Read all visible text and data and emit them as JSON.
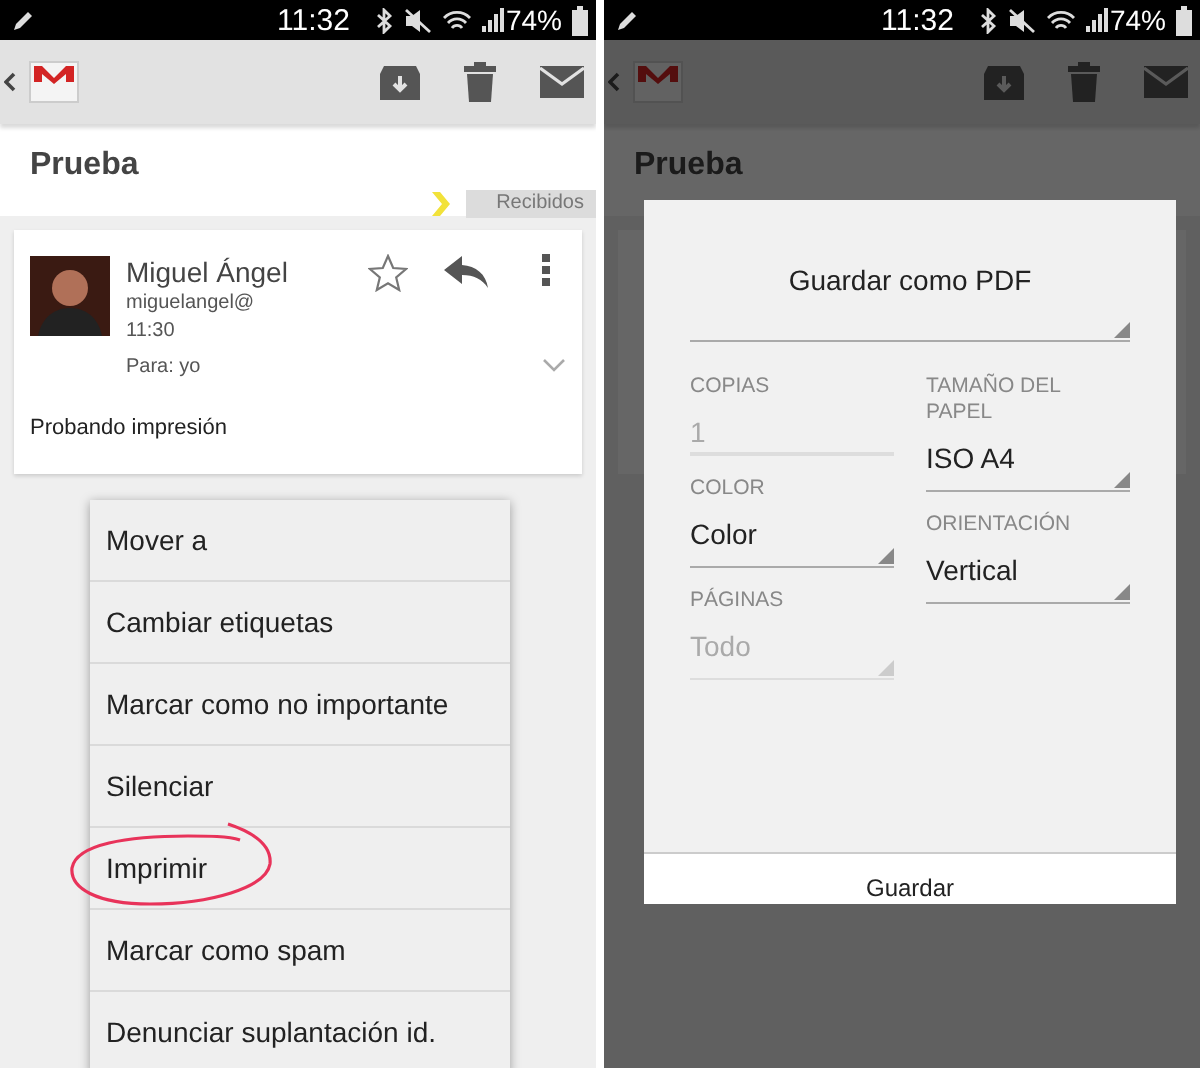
{
  "left_screen": {
    "status_bar": {
      "time": "11:32",
      "battery": "74%"
    },
    "subject": "Prueba",
    "label": "Recibidos",
    "message": {
      "sender": "Miguel Ángel",
      "address": "miguelangel@",
      "time": "11:30",
      "recipient": "Para: yo",
      "starred": false,
      "body": "Probando impresión"
    },
    "menu": [
      {
        "label": "Mover a",
        "circled": false
      },
      {
        "label": "Cambiar etiquetas",
        "circled": false
      },
      {
        "label": "Marcar como no importante",
        "circled": false
      },
      {
        "label": "Silenciar",
        "circled": false
      },
      {
        "label": "Imprimir",
        "circled": true
      },
      {
        "label": "Marcar como spam",
        "circled": false
      },
      {
        "label": "Denunciar suplantación id.",
        "circled": false
      }
    ]
  },
  "right_screen": {
    "status_bar": {
      "time": "11:32",
      "battery": "74%"
    },
    "subject": "Prueba",
    "print_dialog": {
      "printer": "Guardar como PDF",
      "left_fields": [
        {
          "label": "COPIAS",
          "value": "1",
          "kind": "input",
          "disabled": true
        },
        {
          "label": "COLOR",
          "value": "Color",
          "kind": "dropdown",
          "disabled": false
        },
        {
          "label": "PÁGINAS",
          "value": "Todo",
          "kind": "dropdown",
          "disabled": true
        }
      ],
      "right_fields": [
        {
          "label": "TAMAÑO DEL PAPEL",
          "value": "ISO A4",
          "kind": "dropdown",
          "disabled": false
        },
        {
          "label": "ORIENTACIÓN",
          "value": "Vertical",
          "kind": "dropdown",
          "disabled": false
        }
      ],
      "button": "Guardar"
    }
  }
}
